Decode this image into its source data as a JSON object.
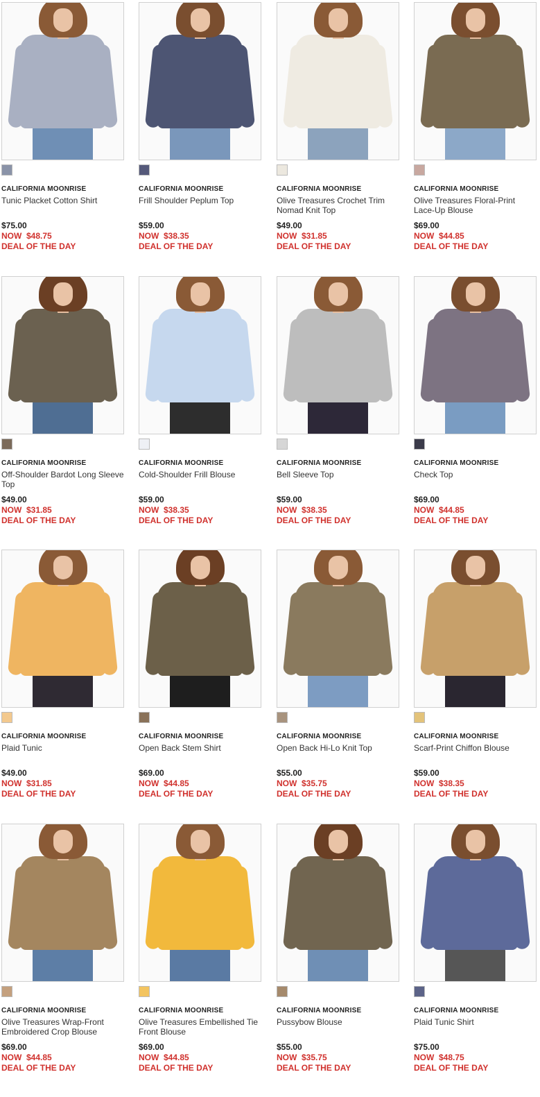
{
  "brand": "CALIFORNIA MOONRISE",
  "now_label": "NOW",
  "deal_label": "DEAL OF THE DAY",
  "products": [
    {
      "name": "Tunic Placket Cotton Shirt",
      "price": "$75.00",
      "sale": "$48.75",
      "swatch": "#8a93a8",
      "garment": "#a9b0c2",
      "pants": "#6f8fb5",
      "hair": "#8a5a36",
      "image": "plaid-shirt"
    },
    {
      "name": "Frill Shoulder Peplum Top",
      "price": "$59.00",
      "sale": "$38.35",
      "swatch": "#55597a",
      "garment": "#4d5573",
      "pants": "#7a97bb",
      "hair": "#7a4e2f",
      "image": "navy-peplum-top"
    },
    {
      "name": "Olive Treasures Crochet Trim Nomad Knit Top",
      "price": "$49.00",
      "sale": "$31.85",
      "swatch": "#ece8df",
      "garment": "#efebe2",
      "pants": "#8ca3bd",
      "hair": "#8a5a36",
      "image": "cream-knit-top"
    },
    {
      "name": "Olive Treasures Floral-Print Lace-Up Blouse",
      "price": "$69.00",
      "sale": "$44.85",
      "swatch": "#c8a8a0",
      "garment": "#7a6b52",
      "pants": "#8ca8c8",
      "hair": "#7a4e2f",
      "image": "floral-blouse"
    },
    {
      "name": "Off-Shoulder Bardot Long Sleeve Top",
      "price": "$49.00",
      "sale": "$31.85",
      "swatch": "#7b6a5a",
      "garment": "#6b6150",
      "pants": "#4f6e93",
      "hair": "#6b3f24",
      "image": "olive-bardot-top"
    },
    {
      "name": "Cold-Shoulder Frill Blouse",
      "price": "$59.00",
      "sale": "$38.35",
      "swatch": "#eef0f5",
      "garment": "#c6d8ee",
      "pants": "#2d2d2d",
      "hair": "#8a5a36",
      "image": "light-blue-blouse"
    },
    {
      "name": "Bell Sleeve Top",
      "price": "$59.00",
      "sale": "$38.35",
      "swatch": "#d6d6d6",
      "garment": "#bdbdbd",
      "pants": "#2d2838",
      "hair": "#8a5a36",
      "image": "gray-bell-sleeve-top"
    },
    {
      "name": "Check Top",
      "price": "$69.00",
      "sale": "$44.85",
      "swatch": "#3b3b4a",
      "garment": "#7d7382",
      "pants": "#7a9cc2",
      "hair": "#7a4e2f",
      "image": "check-top"
    },
    {
      "name": "Plaid Tunic",
      "price": "$49.00",
      "sale": "$31.85",
      "swatch": "#f3c98e",
      "garment": "#efb561",
      "pants": "#2f2a33",
      "hair": "#8a5a36",
      "image": "orange-plaid-tunic"
    },
    {
      "name": "Open Back Stem Shirt",
      "price": "$69.00",
      "sale": "$44.85",
      "swatch": "#8a7259",
      "garment": "#6c6049",
      "pants": "#1e1e1e",
      "hair": "#6b3f24",
      "image": "olive-shirt-dress"
    },
    {
      "name": "Open Back Hi-Lo Knit Top",
      "price": "$55.00",
      "sale": "$35.75",
      "swatch": "#a8937e",
      "garment": "#8a7a5e",
      "pants": "#7d9cc2",
      "hair": "#8a5a36",
      "image": "olive-knit-top"
    },
    {
      "name": "Scarf-Print Chiffon Blouse",
      "price": "$59.00",
      "sale": "$38.35",
      "swatch": "#e3c37a",
      "garment": "#c7a06a",
      "pants": "#2a2630",
      "hair": "#7a4e2f",
      "image": "scarf-print-blouse"
    },
    {
      "name": "Olive Treasures Wrap-Front Embroidered Crop Blouse",
      "price": "$69.00",
      "sale": "$44.85",
      "swatch": "#c4a07e",
      "garment": "#a4865f",
      "pants": "#5d7ea6",
      "hair": "#8a5a36",
      "image": "tan-wrap-blouse"
    },
    {
      "name": "Olive Treasures Embellished Tie Front Blouse",
      "price": "$69.00",
      "sale": "$44.85",
      "swatch": "#f3c460",
      "garment": "#f2b93c",
      "pants": "#5a7aa3",
      "hair": "#8a5a36",
      "image": "mustard-blouse"
    },
    {
      "name": "Pussybow Blouse",
      "price": "$55.00",
      "sale": "$35.75",
      "swatch": "#a58a6c",
      "garment": "#716550",
      "pants": "#6f8fb5",
      "hair": "#6b3f24",
      "image": "olive-pussybow-blouse"
    },
    {
      "name": "Plaid Tunic Shirt",
      "price": "$75.00",
      "sale": "$48.75",
      "swatch": "#5c6388",
      "garment": "#5d6a9a",
      "pants": "#565656",
      "hair": "#7a4e2f",
      "image": "blue-plaid-tunic"
    }
  ]
}
